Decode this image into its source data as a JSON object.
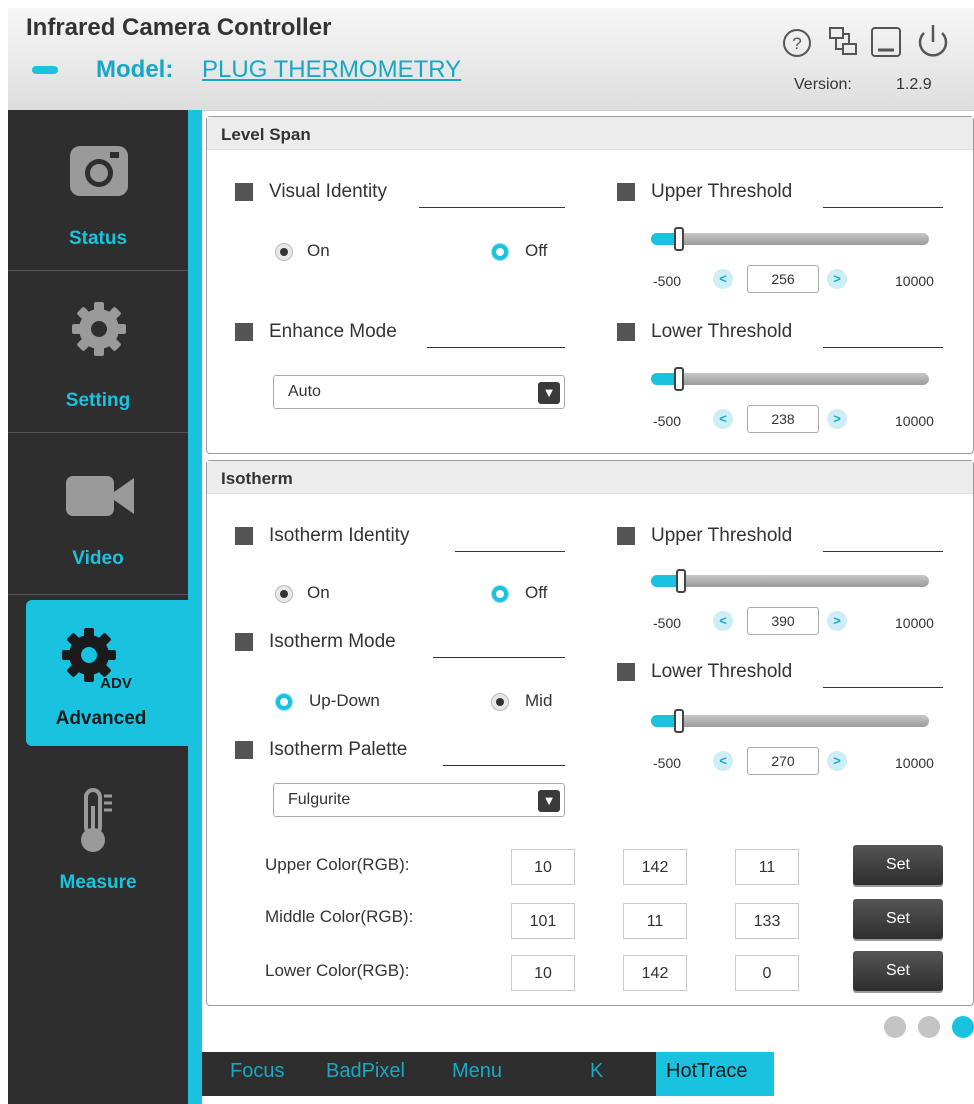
{
  "header": {
    "title": "Infrared Camera Controller",
    "model_label": "Model:",
    "model_value": "PLUG THERMOMETRY",
    "version_label": "Version:",
    "version_value": "1.2.9",
    "icons": [
      "help-icon",
      "network-icon",
      "minimize-icon",
      "power-icon"
    ]
  },
  "sidebar": {
    "items": [
      {
        "label": "Status",
        "icon": "camera-icon"
      },
      {
        "label": "Setting",
        "icon": "gear-icon"
      },
      {
        "label": "Video",
        "icon": "video-camera-icon"
      },
      {
        "label": "Advanced",
        "icon": "gear-adv-icon",
        "badge": "ADV",
        "active": true
      },
      {
        "label": "Measure",
        "icon": "thermometer-icon"
      }
    ]
  },
  "level_span": {
    "title": "Level Span",
    "visual_identity": {
      "label": "Visual Identity",
      "on_label": "On",
      "off_label": "Off",
      "selected": "Off"
    },
    "enhance_mode": {
      "label": "Enhance Mode",
      "value": "Auto"
    },
    "upper_threshold": {
      "label": "Upper Threshold",
      "min": "-500",
      "max": "10000",
      "value": "256"
    },
    "lower_threshold": {
      "label": "Lower Threshold",
      "min": "-500",
      "max": "10000",
      "value": "238"
    }
  },
  "isotherm": {
    "title": "Isotherm",
    "identity": {
      "label": "Isotherm Identity",
      "on_label": "On",
      "off_label": "Off",
      "selected": "Off"
    },
    "mode": {
      "label": "Isotherm Mode",
      "opt1": "Up-Down",
      "opt2": "Mid",
      "selected": "Up-Down"
    },
    "palette": {
      "label": "Isotherm Palette",
      "value": "Fulgurite"
    },
    "upper_threshold": {
      "label": "Upper Threshold",
      "min": "-500",
      "max": "10000",
      "value": "390"
    },
    "lower_threshold": {
      "label": "Lower Threshold",
      "min": "-500",
      "max": "10000",
      "value": "270"
    },
    "colors": [
      {
        "label": "Upper Color(RGB):",
        "r": "10",
        "g": "142",
        "b": "11",
        "button": "Set"
      },
      {
        "label": "Middle Color(RGB):",
        "r": "101",
        "g": "11",
        "b": "133",
        "button": "Set"
      },
      {
        "label": "Lower Color(RGB):",
        "r": "10",
        "g": "142",
        "b": "0",
        "button": "Set"
      }
    ]
  },
  "pagination": {
    "count": 3,
    "active": 3
  },
  "bottom_tabs": [
    {
      "label": "Focus"
    },
    {
      "label": "BadPixel"
    },
    {
      "label": "Menu"
    },
    {
      "label": "K"
    },
    {
      "label": "HotTrace",
      "active": true
    }
  ],
  "colors": {
    "accent": "#19c3df",
    "sidebar": "#2e2e2e",
    "text": "#333333"
  }
}
